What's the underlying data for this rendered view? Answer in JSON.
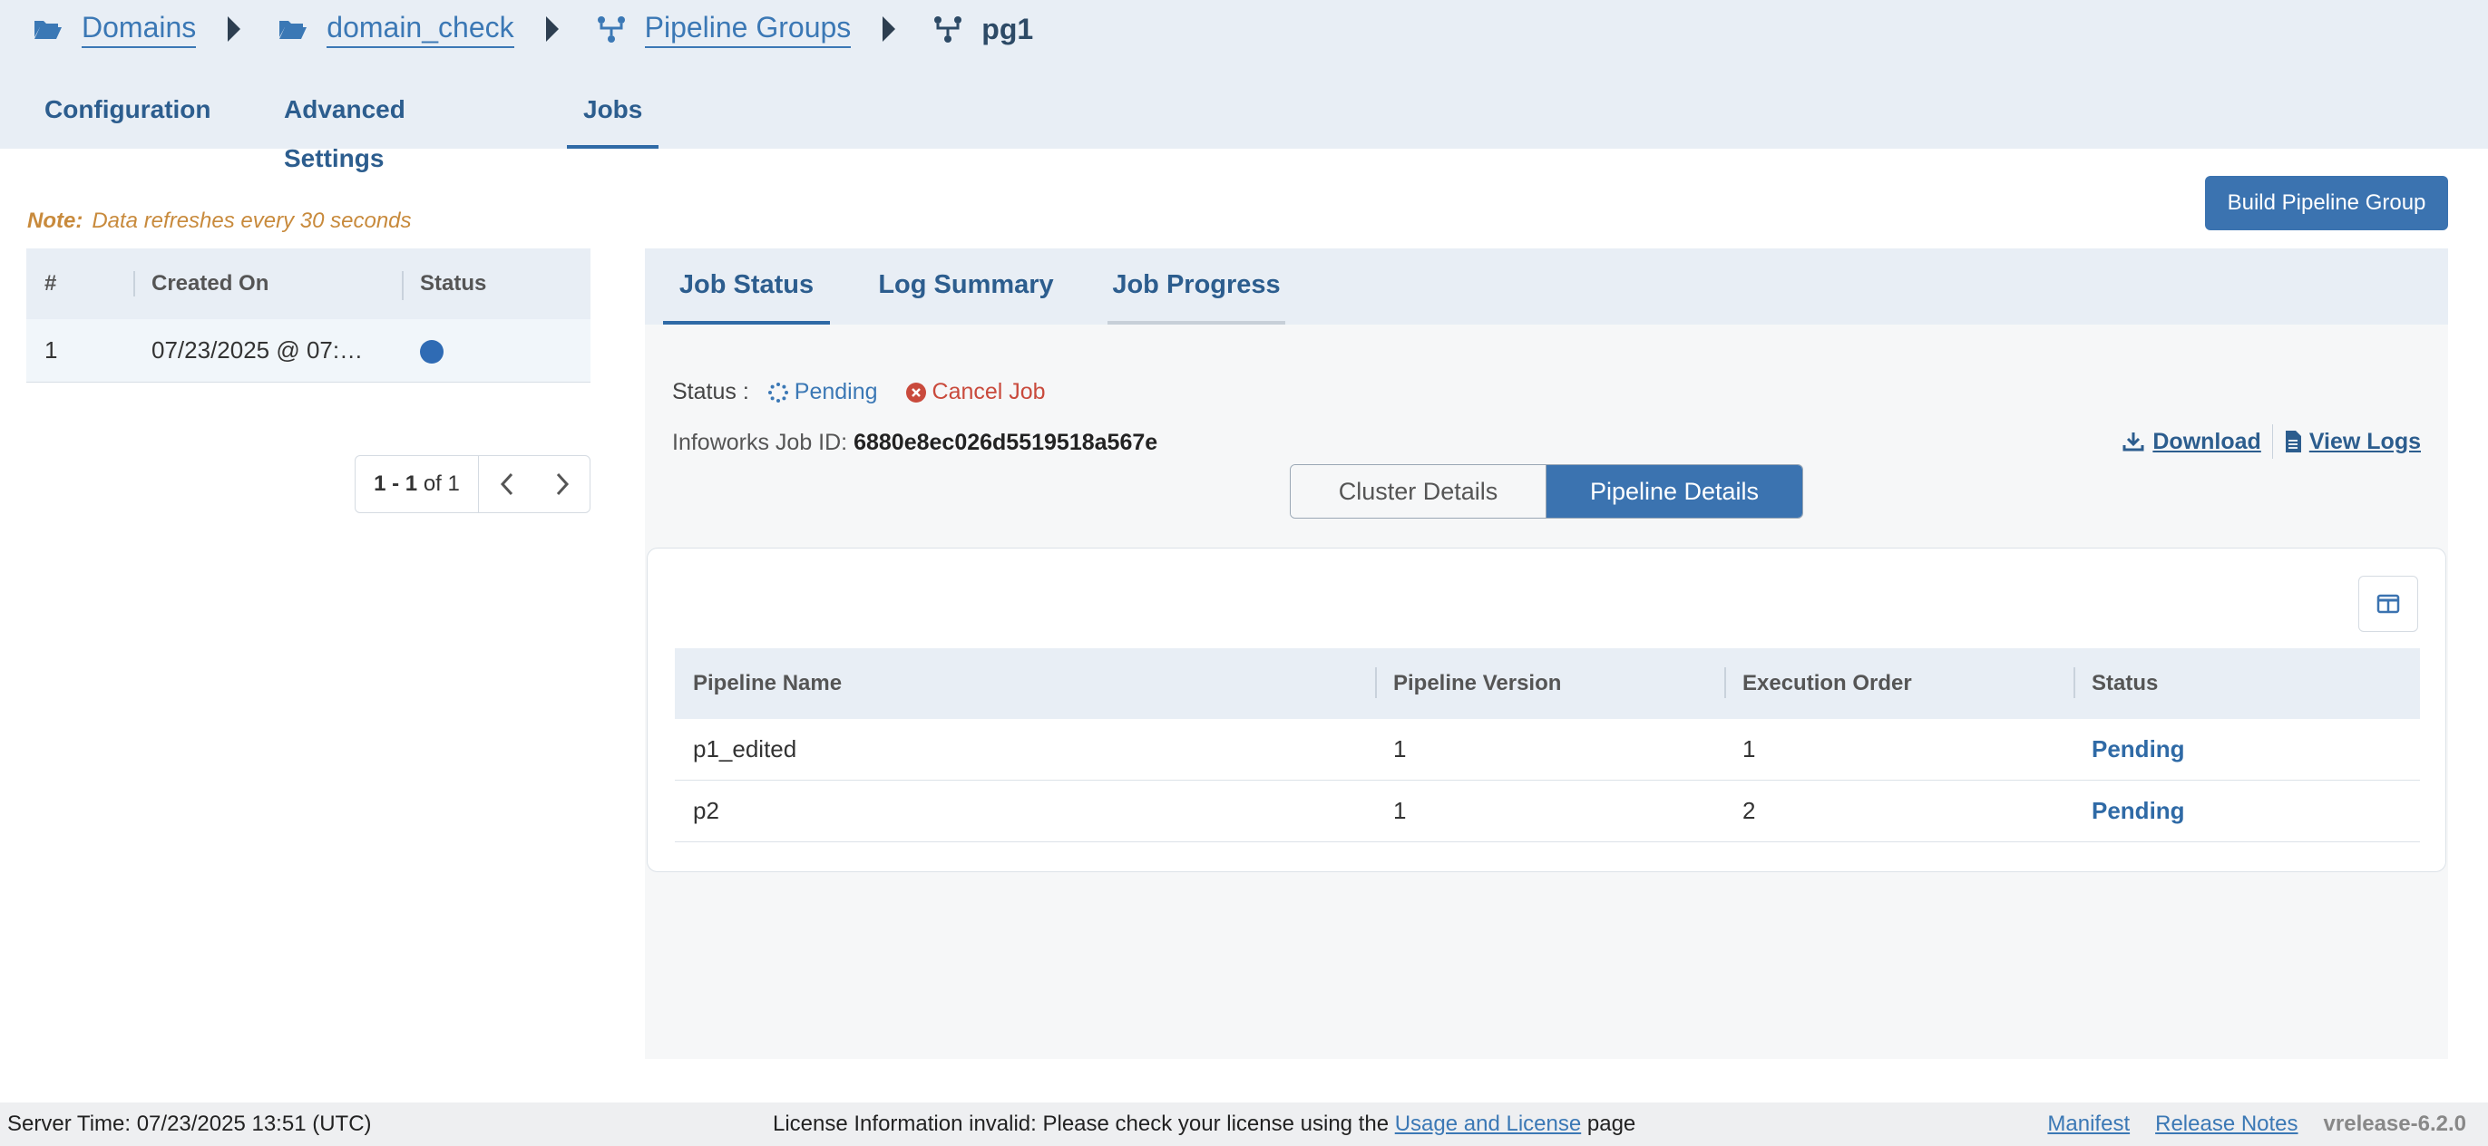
{
  "breadcrumb": {
    "items": [
      {
        "label": "Domains",
        "icon": "folder-open-icon"
      },
      {
        "label": "domain_check",
        "icon": "folder-open-icon"
      },
      {
        "label": "Pipeline Groups",
        "icon": "pipeline-group-icon"
      }
    ],
    "current": {
      "label": "pg1",
      "icon": "pipeline-group-icon"
    }
  },
  "top_tabs": {
    "configuration": "Configuration",
    "advanced_settings": "Advanced Settings",
    "jobs": "Jobs",
    "active": "Jobs"
  },
  "note": {
    "label": "Note:",
    "text": "Data refreshes every 30 seconds"
  },
  "build_button": "Build Pipeline Group",
  "jobs_table": {
    "headers": {
      "index": "#",
      "created_on": "Created On",
      "status": "Status"
    },
    "rows": [
      {
        "index": "1",
        "created_on": "07/23/2025 @ 07:…",
        "status_color": "#2f6bb4"
      }
    ]
  },
  "pagination": {
    "range": "1 - 1",
    "of_label": "of",
    "total": "1"
  },
  "panel_tabs": {
    "job_status": "Job Status",
    "log_summary": "Log Summary",
    "job_progress": "Job Progress",
    "active": "Job Status"
  },
  "job": {
    "status_label": "Status :",
    "status_value": "Pending",
    "cancel_label": "Cancel Job",
    "id_label": "Infoworks Job ID:",
    "id_value": "6880e8ec026d5519518a567e",
    "download_label": "Download",
    "view_logs_label": "View Logs"
  },
  "segments": {
    "cluster": "Cluster Details",
    "pipeline": "Pipeline Details",
    "active": "Pipeline Details"
  },
  "pipelines_table": {
    "headers": {
      "name": "Pipeline Name",
      "version": "Pipeline Version",
      "order": "Execution Order",
      "status": "Status"
    },
    "rows": [
      {
        "name": "p1_edited",
        "version": "1",
        "order": "1",
        "status": "Pending"
      },
      {
        "name": "p2",
        "version": "1",
        "order": "2",
        "status": "Pending"
      }
    ]
  },
  "footer": {
    "server_time": "Server Time: 07/23/2025 13:51 (UTC)",
    "license_prefix": "License Information invalid: Please check your license using the",
    "license_link": "Usage and License",
    "license_suffix": "page",
    "manifest": "Manifest",
    "release_notes": "Release Notes",
    "version": "vrelease-6.2.0"
  },
  "colors": {
    "primary": "#3b73b0",
    "link": "#3b78b5",
    "header_bg": "#e8eef5",
    "note": "#c88a3c",
    "cancel": "#c94a3c"
  }
}
